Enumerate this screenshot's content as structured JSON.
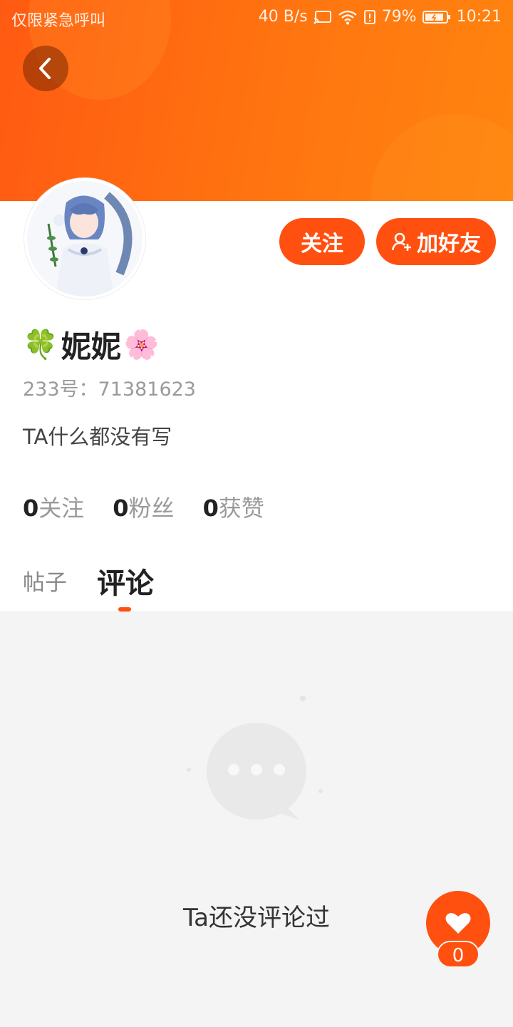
{
  "status_bar": {
    "carrier": "仅限紧急呼叫",
    "speed": "40 B/s",
    "battery": "79%",
    "time": "10:21"
  },
  "colors": {
    "brand": "#ff5010",
    "header_gradient_start": "#ff5a12",
    "header_gradient_end": "#ff840f"
  },
  "icons": {
    "back": "chevron-left-icon",
    "add_friend": "user-plus-icon",
    "empty_state": "chat-bubble-icon",
    "like": "heart-icon"
  },
  "profile": {
    "emoji_before": "🍀",
    "name": "妮妮",
    "emoji_after": "🌸",
    "uid_label": "233号：",
    "uid": "71381623",
    "bio": "TA什么都没有写"
  },
  "actions": {
    "follow": "关注",
    "add_friend": "加好友"
  },
  "stats": [
    {
      "count": "0",
      "label": "关注"
    },
    {
      "count": "0",
      "label": "粉丝"
    },
    {
      "count": "0",
      "label": "获赞"
    }
  ],
  "tabs": [
    {
      "label": "帖子",
      "active": false
    },
    {
      "label": "评论",
      "active": true
    }
  ],
  "empty_state": {
    "message": "Ta还没评论过"
  },
  "like": {
    "count": "0"
  }
}
